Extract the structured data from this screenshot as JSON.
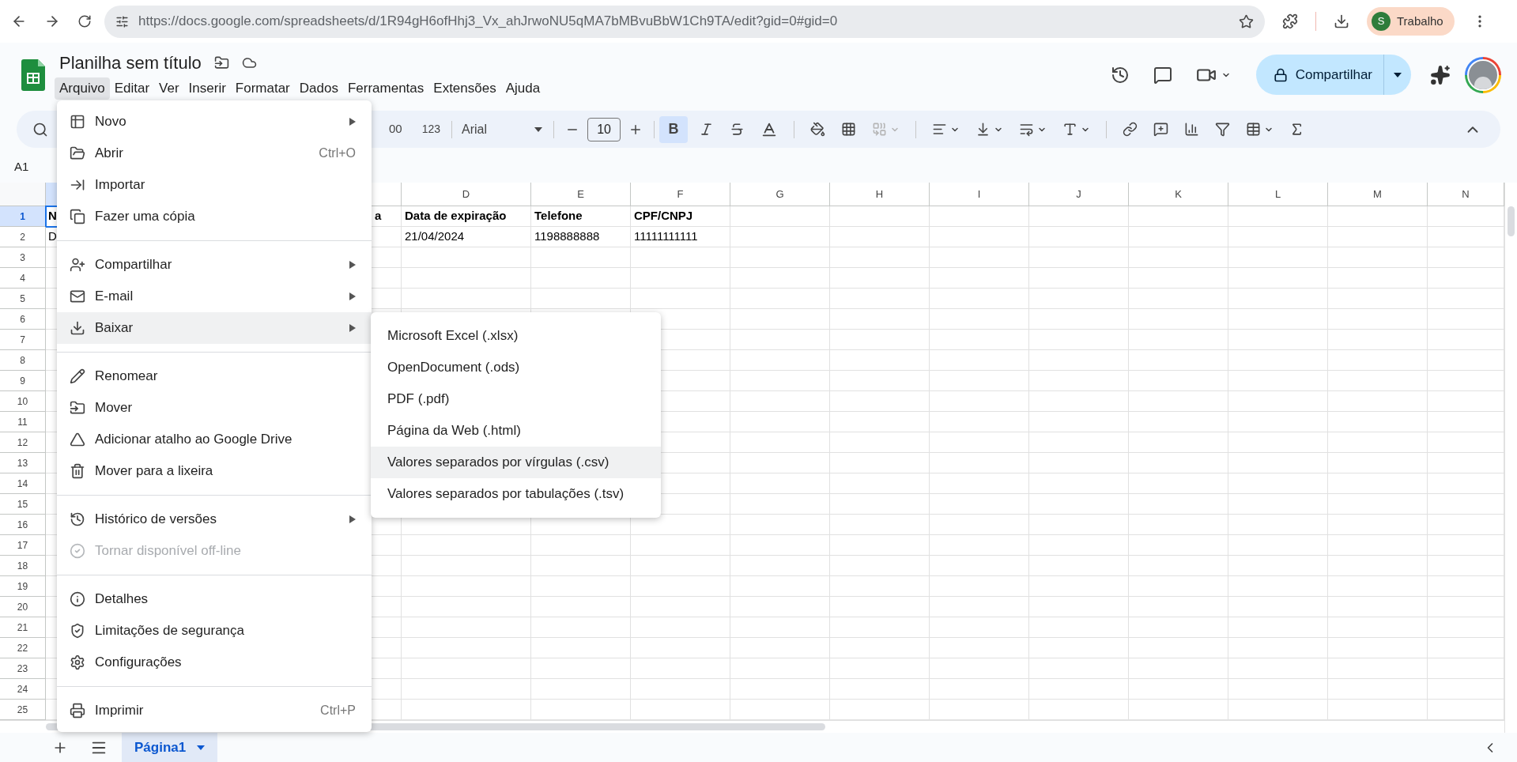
{
  "browser": {
    "url": "https://docs.google.com/spreadsheets/d/1R94gH6ofHhj3_Vx_ahJrwoNU5qMA7bMBvuBbW1Ch9TA/edit?gid=0#gid=0",
    "profile": {
      "initial": "S",
      "name": "Trabalho"
    }
  },
  "header": {
    "title": "Planilha sem título",
    "menus": [
      {
        "label": "Arquivo",
        "selected": true
      },
      {
        "label": "Editar",
        "selected": false
      },
      {
        "label": "Ver",
        "selected": false
      },
      {
        "label": "Inserir",
        "selected": false
      },
      {
        "label": "Formatar",
        "selected": false
      },
      {
        "label": "Dados",
        "selected": false
      },
      {
        "label": "Ferramentas",
        "selected": false
      },
      {
        "label": "Extensões",
        "selected": false
      },
      {
        "label": "Ajuda",
        "selected": false
      }
    ],
    "share_button": "Compartilhar"
  },
  "toolbar": {
    "format_fragment": "00",
    "number_format": "123",
    "font": "Arial",
    "font_size": "10",
    "bold": {
      "label": "B",
      "selected": true
    },
    "merge": {
      "disabled": true
    }
  },
  "formula_bar": {
    "cell_ref": "A1"
  },
  "grid": {
    "columns": [
      "D",
      "E",
      "F",
      "G",
      "H",
      "I",
      "J",
      "K",
      "L",
      "M",
      "N"
    ],
    "rows": [
      {
        "number": "1",
        "selected": true,
        "bold": true,
        "cells": [
          "N",
          null,
          "a",
          "Data de expiração",
          "Telefone",
          "CPF/CNPJ"
        ]
      },
      {
        "number": "2",
        "selected": false,
        "bold": false,
        "cells": [
          "D",
          null,
          null,
          "21/04/2024",
          "1198888888",
          "11111111111"
        ]
      },
      {
        "number": "3",
        "selected": false
      },
      {
        "number": "4",
        "selected": false
      },
      {
        "number": "5",
        "selected": false
      },
      {
        "number": "6",
        "selected": false
      },
      {
        "number": "7",
        "selected": false
      },
      {
        "number": "8",
        "selected": false
      },
      {
        "number": "9",
        "selected": false
      },
      {
        "number": "10",
        "selected": false
      },
      {
        "number": "11",
        "selected": false
      },
      {
        "number": "12",
        "selected": false
      },
      {
        "number": "13",
        "selected": false
      },
      {
        "number": "14",
        "selected": false
      },
      {
        "number": "15",
        "selected": false
      },
      {
        "number": "16",
        "selected": false
      },
      {
        "number": "17",
        "selected": false
      },
      {
        "number": "18",
        "selected": false
      },
      {
        "number": "19",
        "selected": false
      },
      {
        "number": "20",
        "selected": false
      },
      {
        "number": "21",
        "selected": false
      },
      {
        "number": "22",
        "selected": false
      },
      {
        "number": "23",
        "selected": false
      },
      {
        "number": "24",
        "selected": false
      },
      {
        "number": "25",
        "selected": false
      }
    ]
  },
  "file_menu": {
    "items": [
      {
        "kind": "item",
        "label": "Novo",
        "submenu": true,
        "selected": false,
        "disabled": false
      },
      {
        "kind": "item",
        "label": "Abrir",
        "shortcut": "Ctrl+O",
        "submenu": false,
        "selected": false,
        "disabled": false
      },
      {
        "kind": "item",
        "label": "Importar",
        "submenu": false,
        "selected": false,
        "disabled": false
      },
      {
        "kind": "item",
        "label": "Fazer uma cópia",
        "submenu": false,
        "selected": false,
        "disabled": false
      },
      {
        "kind": "separator"
      },
      {
        "kind": "item",
        "label": "Compartilhar",
        "submenu": true,
        "selected": false,
        "disabled": false
      },
      {
        "kind": "item",
        "label": "E-mail",
        "submenu": true,
        "selected": false,
        "disabled": false
      },
      {
        "kind": "item",
        "label": "Baixar",
        "submenu": true,
        "selected": true,
        "disabled": false
      },
      {
        "kind": "separator"
      },
      {
        "kind": "item",
        "label": "Renomear",
        "submenu": false,
        "selected": false,
        "disabled": false
      },
      {
        "kind": "item",
        "label": "Mover",
        "submenu": false,
        "selected": false,
        "disabled": false
      },
      {
        "kind": "item",
        "label": "Adicionar atalho ao Google Drive",
        "submenu": false,
        "selected": false,
        "disabled": false
      },
      {
        "kind": "item",
        "label": "Mover para a lixeira",
        "submenu": false,
        "selected": false,
        "disabled": false
      },
      {
        "kind": "separator"
      },
      {
        "kind": "item",
        "label": "Histórico de versões",
        "submenu": true,
        "selected": false,
        "disabled": false
      },
      {
        "kind": "item",
        "label": "Tornar disponível off-line",
        "submenu": false,
        "selected": false,
        "disabled": true
      },
      {
        "kind": "separator"
      },
      {
        "kind": "item",
        "label": "Detalhes",
        "submenu": false,
        "selected": false,
        "disabled": false
      },
      {
        "kind": "item",
        "label": "Limitações de segurança",
        "submenu": false,
        "selected": false,
        "disabled": false
      },
      {
        "kind": "item",
        "label": "Configurações",
        "submenu": false,
        "selected": false,
        "disabled": false
      },
      {
        "kind": "separator"
      },
      {
        "kind": "item",
        "label": "Imprimir",
        "shortcut": "Ctrl+P",
        "submenu": false,
        "selected": false,
        "disabled": false
      }
    ]
  },
  "download_submenu": {
    "items": [
      {
        "label": "Microsoft Excel (.xlsx)",
        "selected": false
      },
      {
        "label": "OpenDocument (.ods)",
        "selected": false
      },
      {
        "label": "PDF (.pdf)",
        "selected": false
      },
      {
        "label": "Página da Web (.html)",
        "selected": false
      },
      {
        "label": "Valores separados por vírgulas (.csv)",
        "selected": true
      },
      {
        "label": "Valores separados por tabulações (.tsv)",
        "selected": false
      }
    ]
  },
  "sheet_tabs": [
    {
      "label": "Página1",
      "selected": true
    }
  ]
}
